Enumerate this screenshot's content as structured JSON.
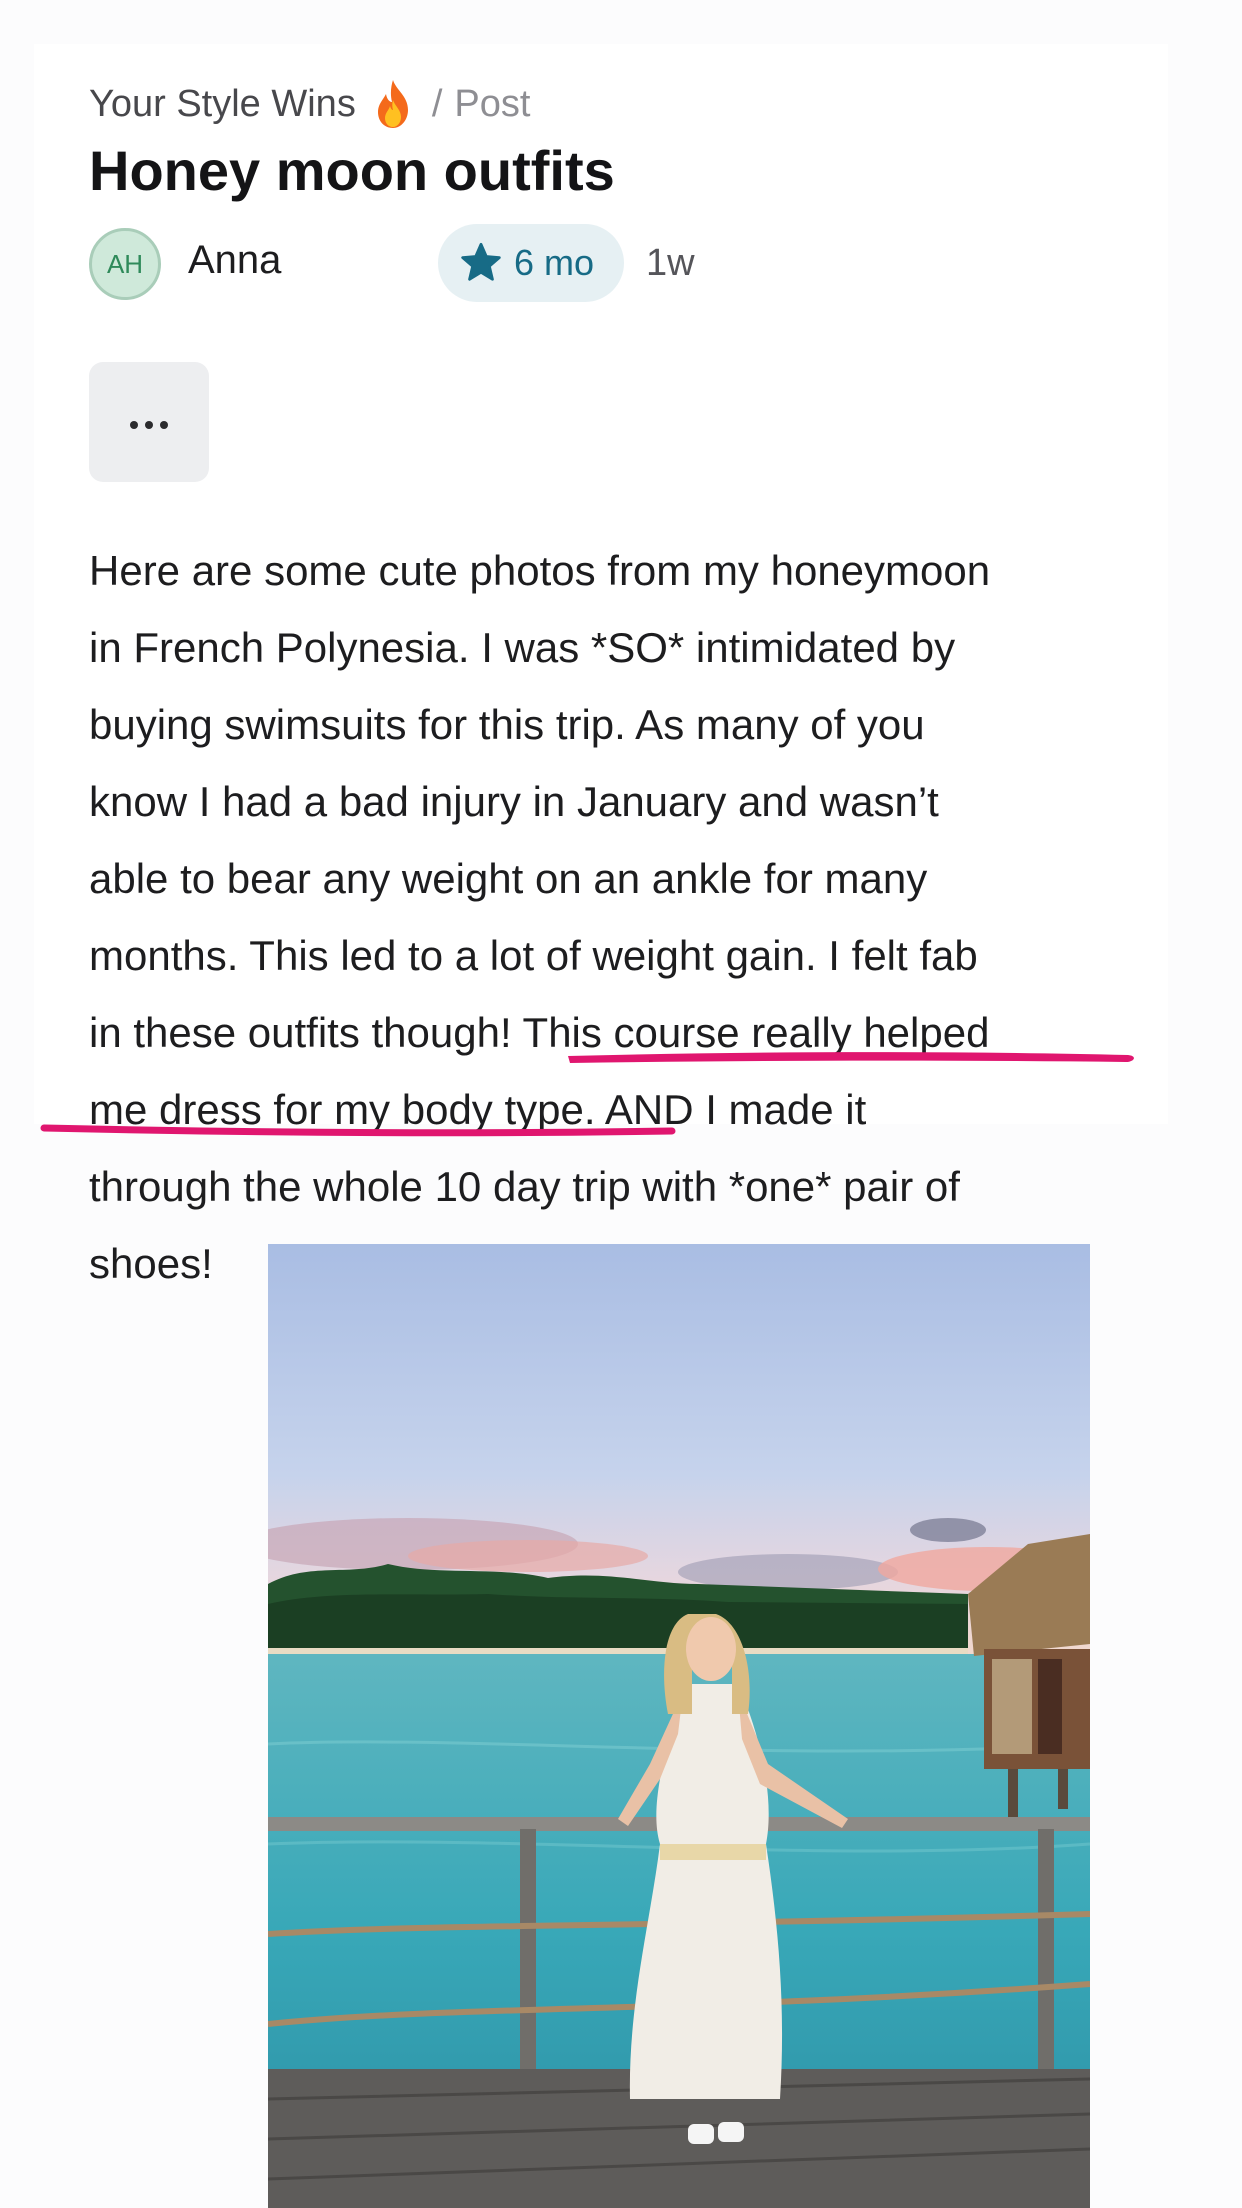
{
  "breadcrumb": {
    "group": "Your Style Wins",
    "separator": "/",
    "current": "Post"
  },
  "post": {
    "title": "Honey moon outfits",
    "author": {
      "initials": "AH",
      "name": "Anna"
    },
    "membership_badge": {
      "label": "6 mo",
      "icon": "star-icon"
    },
    "posted_ago": "1w",
    "more_button_icon": "more-dots-icon",
    "body_lines": [
      "Here are some cute photos from my honeymoon",
      "in French Polynesia. I was *SO* intimidated by",
      "buying swimsuits for this trip. As many of you",
      "know I had a bad injury in January and wasn’t",
      "able to bear any weight on an ankle for many",
      "months. This led to a lot of weight gain. I felt fab",
      "in these outfits though! This course really helped",
      "me dress for my body type. AND I made it",
      "through the whole 10 day trip with *one* pair of",
      "shoes!"
    ]
  },
  "colors": {
    "badge_bg": "#e6f0f3",
    "badge_text": "#176b86",
    "avatar_bg": "#cfe9da",
    "avatar_text": "#2f8a5a",
    "annotation_underline": "#e0166f"
  }
}
